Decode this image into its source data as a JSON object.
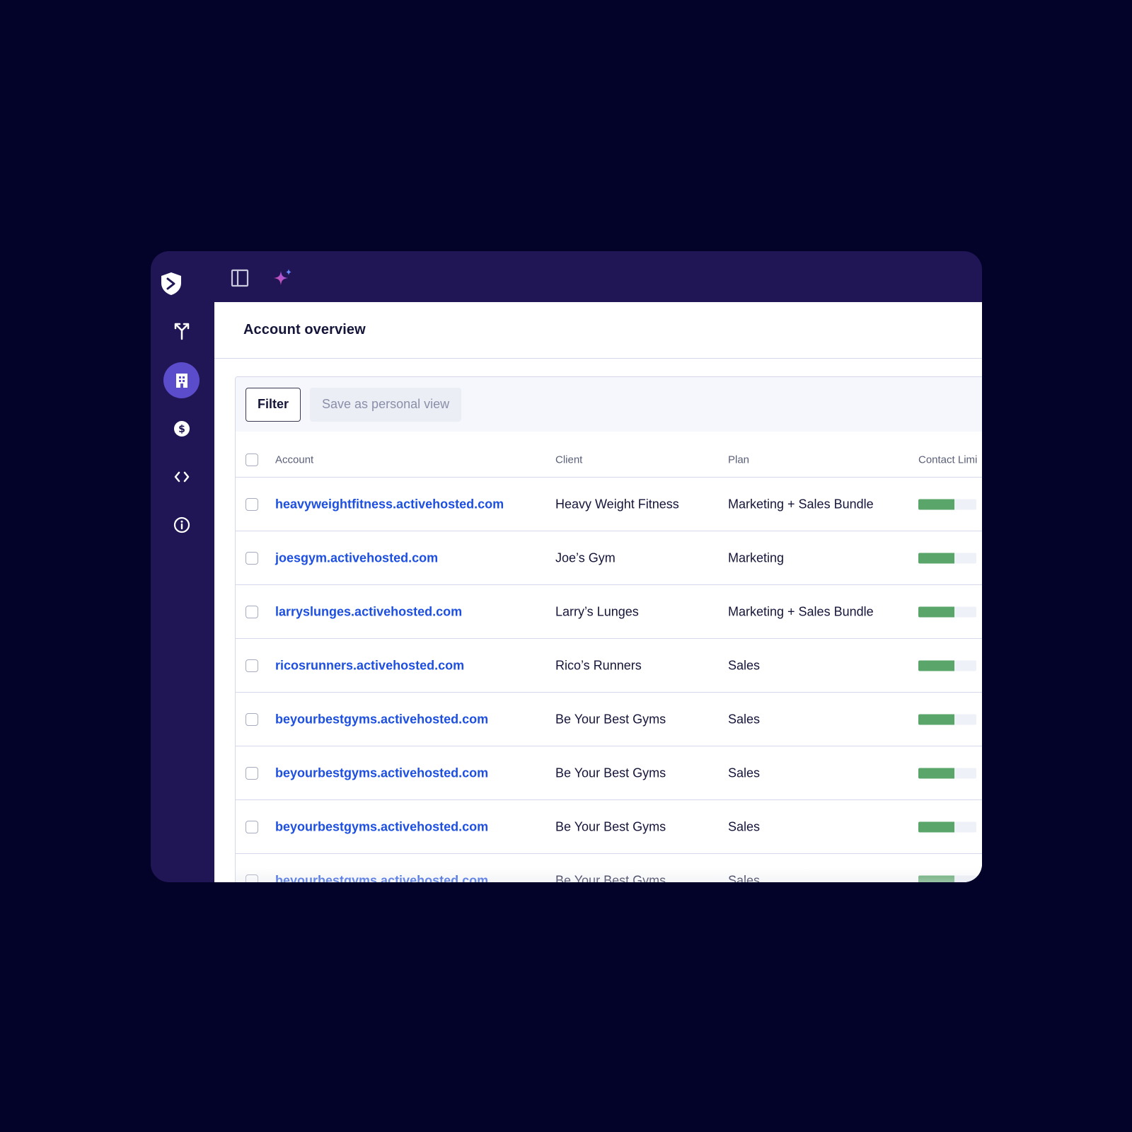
{
  "app": {
    "title": "Account overview"
  },
  "rail": {
    "items": [
      {
        "name": "logo-icon"
      },
      {
        "name": "routes-icon"
      },
      {
        "name": "building-icon",
        "active": true
      },
      {
        "name": "dollar-icon"
      },
      {
        "name": "code-icon"
      },
      {
        "name": "info-icon"
      }
    ]
  },
  "topbar": {
    "icons": [
      "sidebar-toggle-icon",
      "sparkle-icon"
    ]
  },
  "toolbar": {
    "filter_label": "Filter",
    "save_label": "Save as personal view"
  },
  "table": {
    "headers": {
      "account": "Account",
      "client": "Client",
      "plan": "Plan",
      "contact_limit": "Contact Limi"
    },
    "rows": [
      {
        "account": "heavyweightfitness.activehosted.com",
        "client": "Heavy Weight Fitness",
        "plan": "Marketing + Sales Bundle",
        "limit_usage": 0.62
      },
      {
        "account": "joesgym.activehosted.com",
        "client": "Joe’s Gym",
        "plan": "Marketing",
        "limit_usage": 0.62
      },
      {
        "account": "larryslunges.activehosted.com",
        "client": "Larry’s Lunges",
        "plan": "Marketing + Sales Bundle",
        "limit_usage": 0.62
      },
      {
        "account": "ricosrunners.activehosted.com",
        "client": "Rico’s Runners",
        "plan": "Sales",
        "limit_usage": 0.62
      },
      {
        "account": "beyourbestgyms.activehosted.com",
        "client": "Be Your Best Gyms",
        "plan": "Sales",
        "limit_usage": 0.62
      },
      {
        "account": "beyourbestgyms.activehosted.com",
        "client": "Be Your Best Gyms",
        "plan": "Sales",
        "limit_usage": 0.62
      },
      {
        "account": "beyourbestgyms.activehosted.com",
        "client": "Be Your Best Gyms",
        "plan": "Sales",
        "limit_usage": 0.62
      },
      {
        "account": "beyourbestgyms.activehosted.com",
        "client": "Be Your Best Gyms",
        "plan": "Sales",
        "limit_usage": 0.62
      }
    ]
  },
  "colors": {
    "background": "#03032a",
    "window": "#211655",
    "accent": "#5b4ccb",
    "link": "#1d4fe0",
    "bar_fill": "#5aa56a"
  }
}
